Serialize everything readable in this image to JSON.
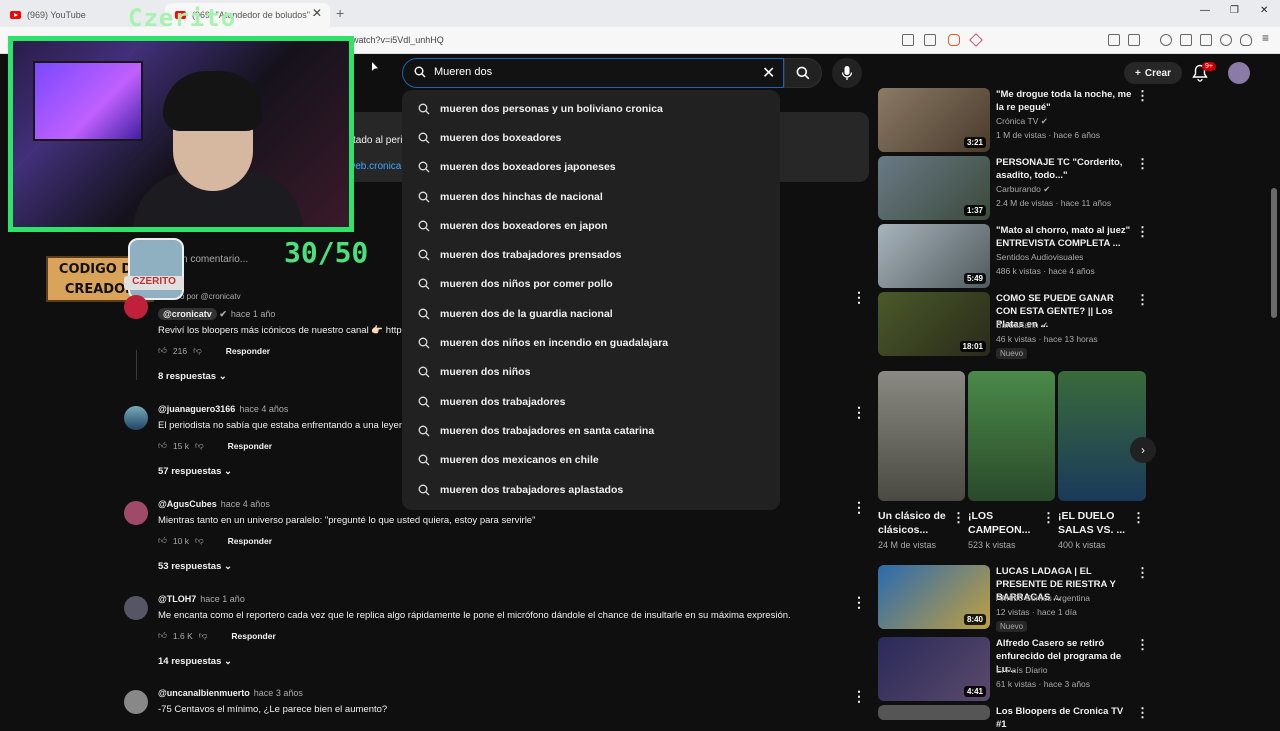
{
  "browser": {
    "tabs": [
      {
        "title": "(969) YouTube"
      },
      {
        "title": "(969) \"Atendedor de boludos\" - "
      }
    ],
    "url": "watch?v=i5Vdl_unhHQ"
  },
  "overlay": {
    "streamer_name": "Czerito",
    "codigo_label": "CODIGO DE CREADOR",
    "mascot_tag": "CZERITO",
    "counter": "30/50"
  },
  "partial_text": {
    "desc": "stado al peri",
    "link": "web.cronica.",
    "add_comment": "n comentario...",
    "pinned": "o por @cronicatv"
  },
  "search": {
    "query": "Mueren dos",
    "suggestions": [
      "mueren dos personas y un boliviano cronica",
      "mueren dos boxeadores",
      "mueren dos boxeadores japoneses",
      "mueren dos hinchas de nacional",
      "mueren dos boxeadores en japon",
      "mueren dos trabajadores prensados",
      "mueren dos niños por comer pollo",
      "mueren dos de la guardia nacional",
      "mueren dos niños en incendio en guadalajara",
      "mueren dos niños",
      "mueren dos trabajadores",
      "mueren dos trabajadores en santa catarina",
      "mueren dos mexicanos en chile",
      "mueren dos trabajadores aplastados"
    ]
  },
  "header": {
    "create_label": "Crear",
    "notif_badge": "9+"
  },
  "comments": [
    {
      "handle": "@cronicatv",
      "time": "hace 1 año",
      "text": "Reviví los bloopers más icónicos de nuestro canal 👉🏻 https",
      "likes": "216",
      "reply": "Responder",
      "replies": "8 respuestas"
    },
    {
      "handle": "@juanaguero3166",
      "time": "hace 4 años",
      "text": "El periodista no sabía que estaba enfrentando a una leyend",
      "likes": "15 k",
      "reply": "Responder",
      "replies": "57 respuestas"
    },
    {
      "handle": "@AgusCubes",
      "time": "hace 4 años",
      "text": "Mientras tanto en un universo paralelo: \"pregunté lo que usted quiera, estoy para servirle\"",
      "likes": "10 k",
      "reply": "Responder",
      "replies": "53 respuestas"
    },
    {
      "handle": "@TLOH7",
      "time": "hace 1 año",
      "text": "Me encanta como el reportero cada vez que le replica algo rápidamente le pone el micrófono dándole el chance de insultarle en su máxima expresión.",
      "likes": "1.6 K",
      "reply": "Responder",
      "replies": "14 respuestas"
    },
    {
      "handle": "@uncanalbienmuerto",
      "time": "hace 3 años",
      "text": "-75 Centavos el mínimo, ¿Le parece bien el aumento?",
      "likes": "",
      "reply": "",
      "replies": ""
    }
  ],
  "videos": [
    {
      "title": "\"Me drogue toda la noche, me la re pegué\"",
      "channel": "Crónica TV",
      "meta": "1 M de vistas · hace 6 años",
      "duration": "3:21",
      "badge": "",
      "thumb_color": "#7a6a58"
    },
    {
      "title": "PERSONAJE TC \"Corderito, asadito, todo...\"",
      "channel": "Carburando",
      "meta": "2.4 M de vistas · hace 11 años",
      "duration": "1:37",
      "badge": "",
      "thumb_color": "#5b6c77"
    },
    {
      "title": "\"Mato al chorro, mato al juez\" ENTREVISTA COMPLETA ...",
      "channel": "Sentidos Audiovisuales",
      "meta": "486 k vistas · hace 4 años",
      "duration": "5:49",
      "badge": "",
      "thumb_color": "#8a9aa8"
    },
    {
      "title": "COMO SE PUEDE GANAR CON ESTA GENTE? || Los Platas en ...",
      "channel": "BarbaKahn",
      "meta": "46 k vistas · hace 13 horas",
      "duration": "18:01",
      "badge": "Nuevo",
      "thumb_color": "#3d4a2a"
    }
  ],
  "shorts": [
    {
      "title": "Un clásico de clásicos...",
      "views": "24 M de vistas",
      "color": "#6a6a62"
    },
    {
      "title": "¡LOS CAMPEON...",
      "views": "523 k vistas",
      "color": "#3a6a3a"
    },
    {
      "title": "¡EL DUELO SALAS VS. ...",
      "views": "400 k vistas",
      "color": "#2a4a2a"
    }
  ],
  "videos2": [
    {
      "title": "LUCAS LADAGA | EL PRESENTE DE RIESTRA Y BARRACAS ...",
      "channel": "AM650 Somos Argentina",
      "meta": "12 vistas · hace 1 día",
      "duration": "8:40",
      "badge": "Nuevo",
      "thumb_color": "#2a5aa0"
    },
    {
      "title": "Alfredo Casero se retiró enfurecido del programa de Lu...",
      "channel": "El País Diario",
      "meta": "61 k vistas · hace 3 años",
      "duration": "4:41",
      "badge": "",
      "thumb_color": "#2a2a4a"
    },
    {
      "title": "Los Bloopers de Cronica TV #1",
      "channel": "",
      "meta": "",
      "duration": "",
      "badge": "",
      "thumb_color": "#444"
    }
  ]
}
